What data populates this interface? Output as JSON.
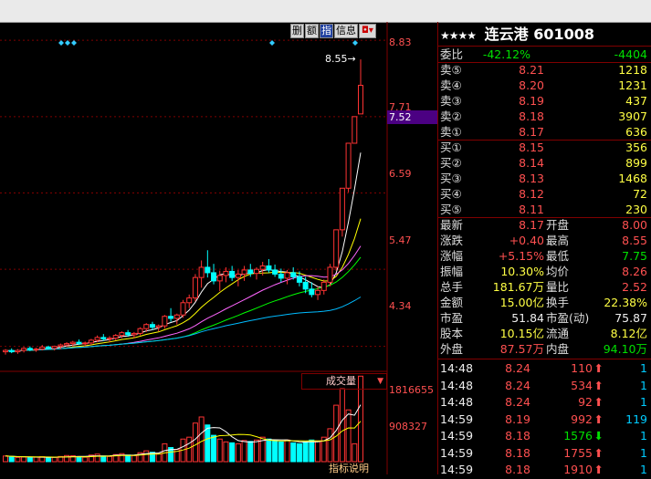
{
  "toolbar": {
    "tabs": [
      {
        "label": "删",
        "active": false
      },
      {
        "label": "额",
        "active": false
      },
      {
        "label": "指",
        "active": true
      },
      {
        "label": "信息",
        "active": false
      }
    ],
    "close_label": "◘▾"
  },
  "stock": {
    "stars": "★★★★",
    "name": "连云港",
    "code": "601008"
  },
  "price_axis": {
    "labels": [
      "8.83",
      "7.71",
      "7.52",
      "6.59",
      "5.47",
      "4.34"
    ],
    "highlight": "7.52"
  },
  "annotation": {
    "price_text": "8.55"
  },
  "volume_axis": {
    "labels": [
      "1816655",
      "908327"
    ]
  },
  "volume_tab": {
    "label": "成交量",
    "arrow": "▼"
  },
  "bottom_tab": {
    "label": "指标说明"
  },
  "quote": {
    "weibi": {
      "label": "委比",
      "pct": "-42.12%",
      "diff": "-4404"
    },
    "sells": [
      {
        "label": "卖⑤",
        "price": "8.21",
        "vol": "1218"
      },
      {
        "label": "卖④",
        "price": "8.20",
        "vol": "1231"
      },
      {
        "label": "卖③",
        "price": "8.19",
        "vol": "437"
      },
      {
        "label": "卖②",
        "price": "8.18",
        "vol": "3907"
      },
      {
        "label": "卖①",
        "price": "8.17",
        "vol": "636"
      }
    ],
    "buys": [
      {
        "label": "买①",
        "price": "8.15",
        "vol": "356"
      },
      {
        "label": "买②",
        "price": "8.14",
        "vol": "899"
      },
      {
        "label": "买③",
        "price": "8.13",
        "vol": "1468"
      },
      {
        "label": "买④",
        "price": "8.12",
        "vol": "72"
      },
      {
        "label": "买⑤",
        "price": "8.11",
        "vol": "230"
      }
    ],
    "stats": [
      {
        "l1": "最新",
        "v1": "8.17",
        "l2": "开盘",
        "v2": "8.00",
        "c1": "red",
        "c2": "red"
      },
      {
        "l1": "涨跌",
        "v1": "+0.40",
        "l2": "最高",
        "v2": "8.55",
        "c1": "red",
        "c2": "red"
      },
      {
        "l1": "涨幅",
        "v1": "+5.15%",
        "l2": "最低",
        "v2": "7.75",
        "c1": "red",
        "c2": "green"
      },
      {
        "l1": "振幅",
        "v1": "10.30%",
        "l2": "均价",
        "v2": "8.26",
        "c1": "yellow",
        "c2": "red"
      },
      {
        "l1": "总手",
        "v1": "181.67万",
        "l2": "量比",
        "v2": "2.52",
        "c1": "yellow",
        "c2": "red"
      },
      {
        "l1": "金额",
        "v1": "15.00亿",
        "l2": "换手",
        "v2": "22.38%",
        "c1": "yellow",
        "c2": "yellow"
      },
      {
        "l1": "市盈",
        "v1": "51.84",
        "l2": "市盈(动)",
        "v2": "75.87",
        "c1": "white",
        "c2": "white"
      },
      {
        "l1": "股本",
        "v1": "10.15亿",
        "l2": "流通",
        "v2": "8.12亿",
        "c1": "yellow",
        "c2": "yellow"
      },
      {
        "l1": "外盘",
        "v1": "87.57万",
        "l2": "内盘",
        "v2": "94.10万",
        "c1": "red",
        "c2": "green"
      }
    ],
    "ticks": [
      {
        "time": "14:48",
        "price": "8.24",
        "vol": "110",
        "dir": "up",
        "n": "1"
      },
      {
        "time": "14:48",
        "price": "8.24",
        "vol": "534",
        "dir": "up",
        "n": "1"
      },
      {
        "time": "14:48",
        "price": "8.24",
        "vol": "92",
        "dir": "up",
        "n": "1"
      },
      {
        "time": "14:59",
        "price": "8.19",
        "vol": "992",
        "dir": "up",
        "n": "119"
      },
      {
        "time": "14:59",
        "price": "8.18",
        "vol": "1576",
        "dir": "down",
        "n": "1"
      },
      {
        "time": "14:59",
        "price": "8.18",
        "vol": "1755",
        "dir": "up",
        "n": "1"
      },
      {
        "time": "14:59",
        "price": "8.18",
        "vol": "1910",
        "dir": "up",
        "n": "1"
      }
    ]
  },
  "colors": {
    "up": "#ff3333",
    "down": "#00ffff",
    "ma5": "#ffffff",
    "ma10": "#ffff00",
    "ma20": "#ff66ff",
    "ma30": "#00ff00",
    "ma60": "#00bbff"
  },
  "chart_data": {
    "type": "candlestick",
    "price_ylim": [
      4.0,
      9.1
    ],
    "candles": [
      [
        4.26,
        4.3,
        4.22,
        4.28
      ],
      [
        4.28,
        4.31,
        4.24,
        4.26
      ],
      [
        4.26,
        4.3,
        4.23,
        4.28
      ],
      [
        4.28,
        4.33,
        4.25,
        4.31
      ],
      [
        4.31,
        4.34,
        4.27,
        4.29
      ],
      [
        4.29,
        4.32,
        4.26,
        4.3
      ],
      [
        4.3,
        4.36,
        4.28,
        4.33
      ],
      [
        4.33,
        4.35,
        4.29,
        4.31
      ],
      [
        4.31,
        4.35,
        4.28,
        4.34
      ],
      [
        4.34,
        4.38,
        4.3,
        4.36
      ],
      [
        4.36,
        4.4,
        4.33,
        4.38
      ],
      [
        4.38,
        4.42,
        4.34,
        4.4
      ],
      [
        4.4,
        4.44,
        4.36,
        4.38
      ],
      [
        4.38,
        4.41,
        4.34,
        4.39
      ],
      [
        4.39,
        4.45,
        4.36,
        4.43
      ],
      [
        4.43,
        4.5,
        4.4,
        4.47
      ],
      [
        4.47,
        4.52,
        4.42,
        4.45
      ],
      [
        4.45,
        4.49,
        4.4,
        4.46
      ],
      [
        4.46,
        4.52,
        4.43,
        4.5
      ],
      [
        4.5,
        4.56,
        4.46,
        4.54
      ],
      [
        4.54,
        4.58,
        4.48,
        4.51
      ],
      [
        4.51,
        4.55,
        4.46,
        4.53
      ],
      [
        4.53,
        4.62,
        4.5,
        4.6
      ],
      [
        4.6,
        4.68,
        4.55,
        4.66
      ],
      [
        4.66,
        4.7,
        4.58,
        4.62
      ],
      [
        4.62,
        4.66,
        4.56,
        4.64
      ],
      [
        4.64,
        4.8,
        4.6,
        4.78
      ],
      [
        4.78,
        4.9,
        4.7,
        4.75
      ],
      [
        4.75,
        4.82,
        4.66,
        4.8
      ],
      [
        4.8,
        5.02,
        4.76,
        4.98
      ],
      [
        4.98,
        5.1,
        4.9,
        5.05
      ],
      [
        5.05,
        5.4,
        5.0,
        5.35
      ],
      [
        5.35,
        5.6,
        5.2,
        5.5
      ],
      [
        5.5,
        5.75,
        5.35,
        5.42
      ],
      [
        5.42,
        5.55,
        5.25,
        5.3
      ],
      [
        5.3,
        5.45,
        5.15,
        5.38
      ],
      [
        5.38,
        5.5,
        5.28,
        5.44
      ],
      [
        5.44,
        5.52,
        5.3,
        5.35
      ],
      [
        5.35,
        5.46,
        5.22,
        5.4
      ],
      [
        5.4,
        5.52,
        5.3,
        5.46
      ],
      [
        5.46,
        5.55,
        5.36,
        5.41
      ],
      [
        5.41,
        5.5,
        5.32,
        5.47
      ],
      [
        5.47,
        5.58,
        5.38,
        5.52
      ],
      [
        5.52,
        5.62,
        5.42,
        5.46
      ],
      [
        5.46,
        5.54,
        5.36,
        5.4
      ],
      [
        5.4,
        5.48,
        5.28,
        5.34
      ],
      [
        5.34,
        5.46,
        5.25,
        5.42
      ],
      [
        5.42,
        5.5,
        5.32,
        5.36
      ],
      [
        5.36,
        5.44,
        5.22,
        5.28
      ],
      [
        5.28,
        5.36,
        5.12,
        5.18
      ],
      [
        5.18,
        5.28,
        5.06,
        5.1
      ],
      [
        5.1,
        5.22,
        5.02,
        5.16
      ],
      [
        5.16,
        5.32,
        5.1,
        5.28
      ],
      [
        5.28,
        5.55,
        5.22,
        5.5
      ],
      [
        5.5,
        6.05,
        5.45,
        6.05
      ],
      [
        6.05,
        6.66,
        5.95,
        6.66
      ],
      [
        6.66,
        7.32,
        6.6,
        7.32
      ],
      [
        7.32,
        7.71,
        7.32,
        7.71
      ],
      [
        7.75,
        8.55,
        7.75,
        8.17
      ]
    ],
    "volumes": [
      120000,
      110000,
      90000,
      100000,
      85000,
      95000,
      105000,
      80000,
      92000,
      110000,
      130000,
      125000,
      100000,
      95000,
      140000,
      160000,
      120000,
      110000,
      150000,
      170000,
      140000,
      130000,
      190000,
      230000,
      200000,
      170000,
      380000,
      300000,
      260000,
      480000,
      520000,
      820000,
      950000,
      780000,
      560000,
      480000,
      420000,
      400000,
      380000,
      450000,
      430000,
      460000,
      520000,
      480000,
      440000,
      420000,
      460000,
      400000,
      380000,
      420000,
      460000,
      440000,
      520000,
      700000,
      1200000,
      1550000,
      1100000,
      380000,
      1816655
    ],
    "volume_ylim": [
      0,
      1900000
    ]
  }
}
